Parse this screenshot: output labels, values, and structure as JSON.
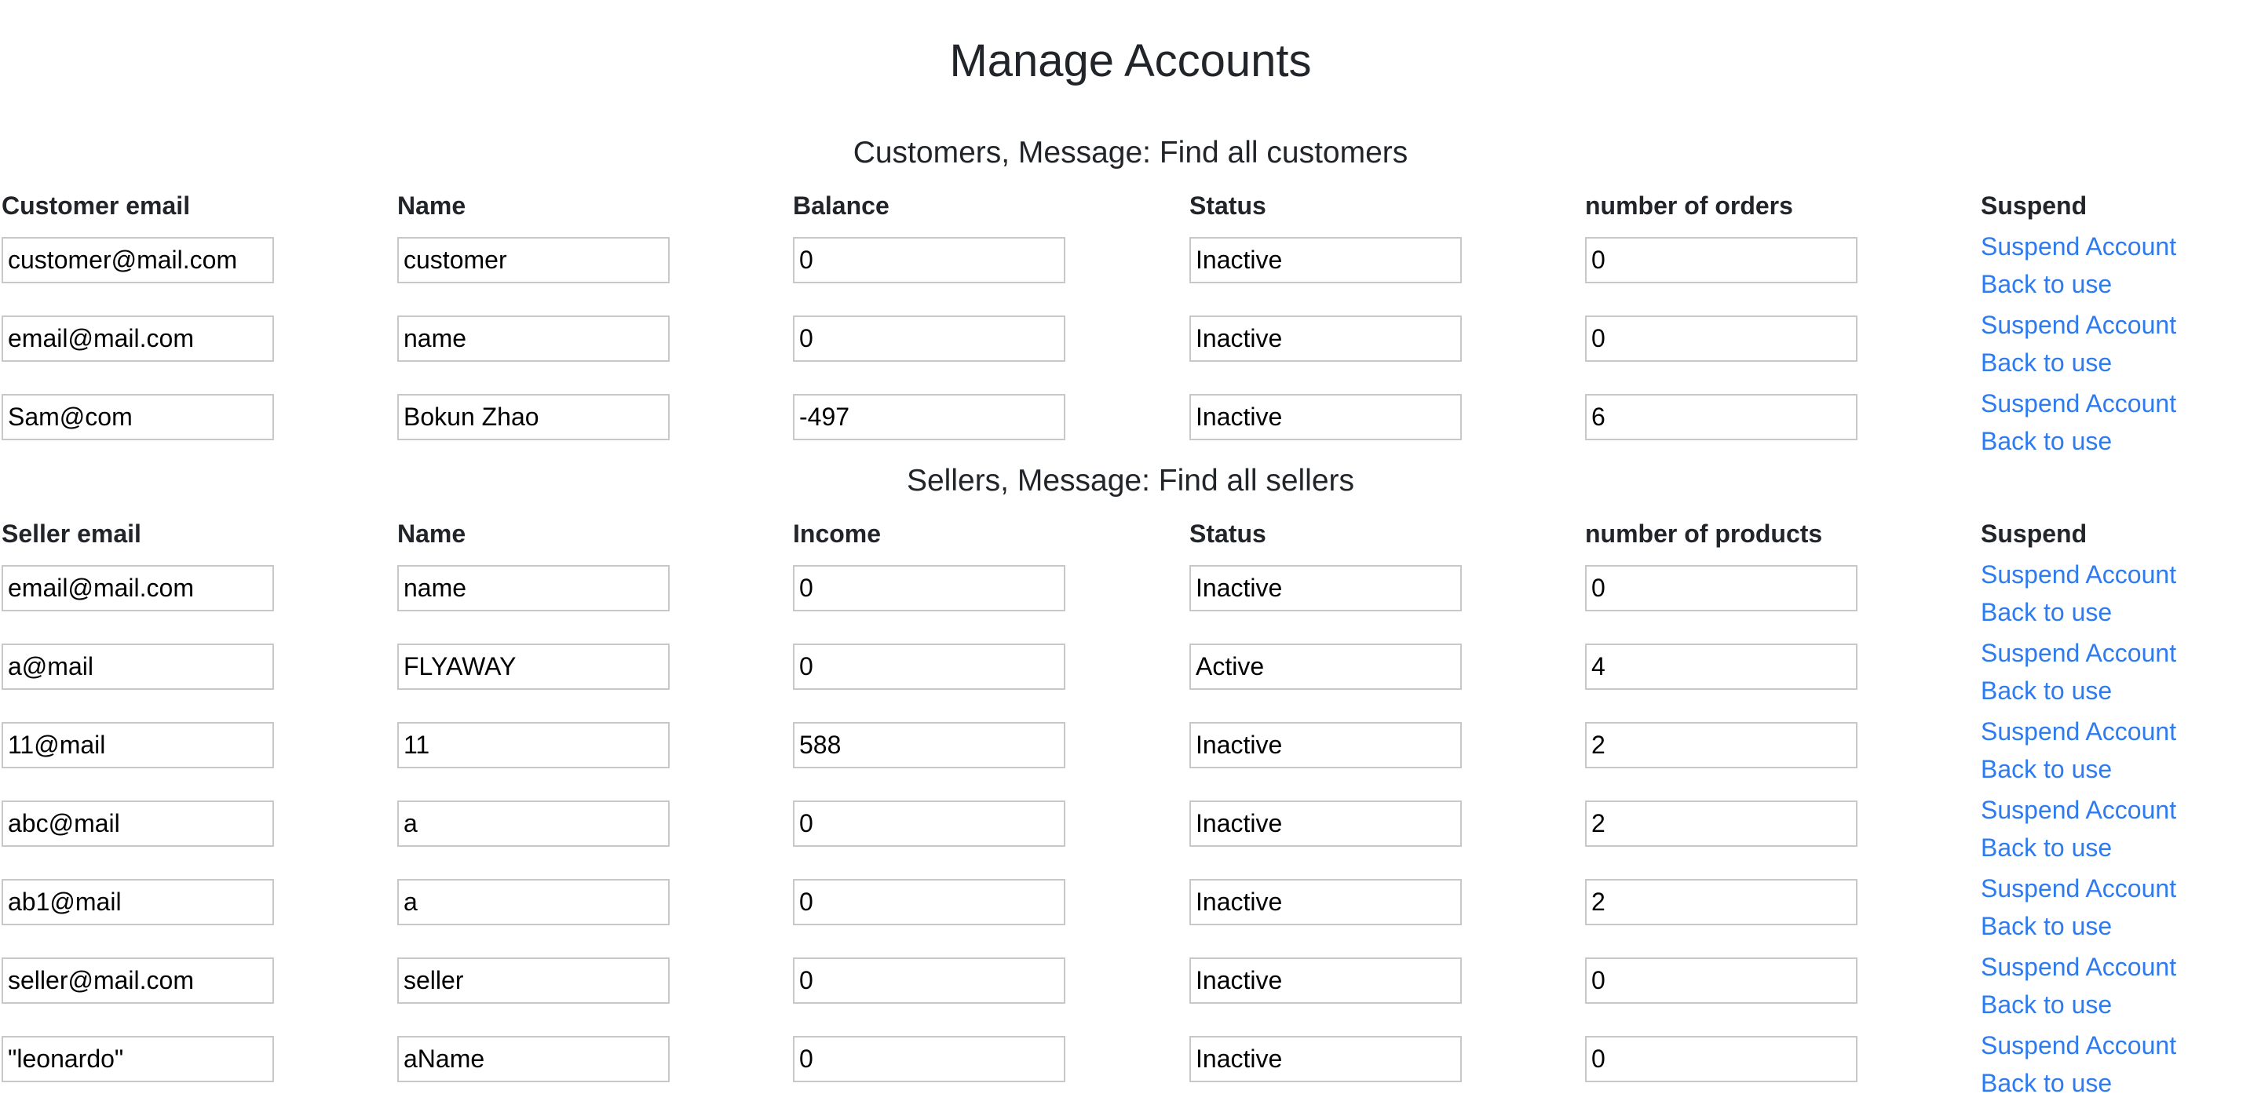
{
  "page": {
    "title": "Manage Accounts"
  },
  "customers": {
    "heading": "Customers, Message: Find all customers",
    "columns": [
      "Customer email",
      "Name",
      "Balance",
      "Status",
      "number of orders",
      "Suspend"
    ],
    "rows": [
      {
        "email": "customer@mail.com",
        "name": "customer",
        "amount": "0",
        "status": "Inactive",
        "count": "0"
      },
      {
        "email": "email@mail.com",
        "name": "name",
        "amount": "0",
        "status": "Inactive",
        "count": "0"
      },
      {
        "email": "Sam@com",
        "name": "Bokun Zhao",
        "amount": "-497",
        "status": "Inactive",
        "count": "6"
      }
    ]
  },
  "sellers": {
    "heading": "Sellers, Message: Find all sellers",
    "columns": [
      "Seller email",
      "Name",
      "Income",
      "Status",
      "number of products",
      "Suspend"
    ],
    "rows": [
      {
        "email": "email@mail.com",
        "name": "name",
        "amount": "0",
        "status": "Inactive",
        "count": "0"
      },
      {
        "email": "a@mail",
        "name": "FLYAWAY",
        "amount": "0",
        "status": "Active",
        "count": "4"
      },
      {
        "email": "11@mail",
        "name": "11",
        "amount": "588",
        "status": "Inactive",
        "count": "2"
      },
      {
        "email": "abc@mail",
        "name": "a",
        "amount": "0",
        "status": "Inactive",
        "count": "2"
      },
      {
        "email": "ab1@mail",
        "name": "a",
        "amount": "0",
        "status": "Inactive",
        "count": "2"
      },
      {
        "email": "seller@mail.com",
        "name": "seller",
        "amount": "0",
        "status": "Inactive",
        "count": "0"
      },
      {
        "email": "\"leonardo\"",
        "name": "aName",
        "amount": "0",
        "status": "Inactive",
        "count": "0"
      }
    ]
  },
  "actions": {
    "suspend_label": "Suspend Account",
    "restore_label": "Back to use"
  },
  "colors": {
    "link": "#2e7bf0",
    "text": "#212529",
    "input_border": "#c8c8c8"
  }
}
